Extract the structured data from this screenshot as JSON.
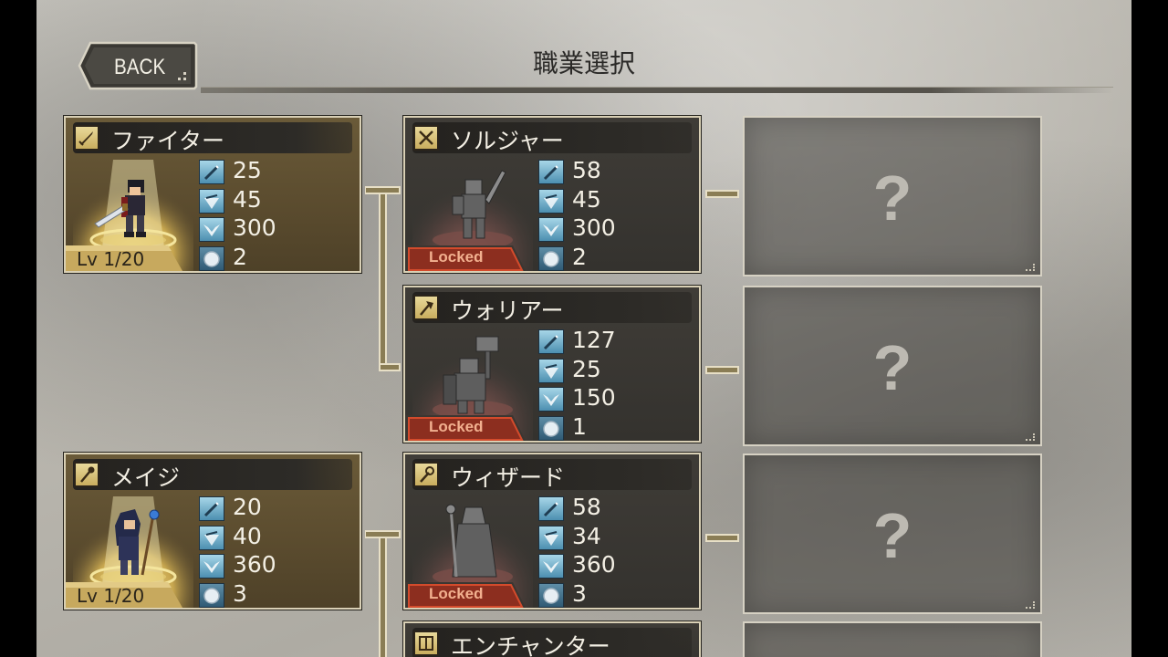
{
  "header": {
    "back_label": "BACK",
    "title": "職業選択"
  },
  "cards": [
    {
      "name": "ファイター",
      "state": "unlocked",
      "level": "Lv 1/20",
      "stats": [
        "25",
        "45",
        "300",
        "2"
      ],
      "icon": "sword-icon",
      "hero": "fighter"
    },
    {
      "name": "ソルジャー",
      "state": "locked",
      "tag": "Locked",
      "stats": [
        "58",
        "45",
        "300",
        "2"
      ],
      "icon": "crossed-swords-icon",
      "hero": "soldier"
    },
    {
      "name": "ウォリアー",
      "state": "locked",
      "tag": "Locked",
      "stats": [
        "127",
        "25",
        "150",
        "1"
      ],
      "icon": "axe-icon",
      "hero": "warrior"
    },
    {
      "name": "メイジ",
      "state": "unlocked",
      "level": "Lv 1/20",
      "stats": [
        "20",
        "40",
        "360",
        "3"
      ],
      "icon": "staff-icon",
      "hero": "mage"
    },
    {
      "name": "ウィザード",
      "state": "locked",
      "tag": "Locked",
      "stats": [
        "58",
        "34",
        "360",
        "3"
      ],
      "icon": "magic-staff-icon",
      "hero": "wizard"
    },
    {
      "name": "エンチャンター",
      "state": "locked",
      "icon": "book-icon",
      "hero": "enchanter"
    }
  ],
  "unknown_slots": [
    "?",
    "?",
    "?",
    "?"
  ],
  "stat_icons": [
    "attack-icon",
    "defense-icon",
    "hp-icon",
    "cost-icon"
  ],
  "colors": {
    "gold": "#c7a95e",
    "locked_red": "#c9432a",
    "stat_blue": "#4c8fb0",
    "text_light": "#f3efe4"
  }
}
